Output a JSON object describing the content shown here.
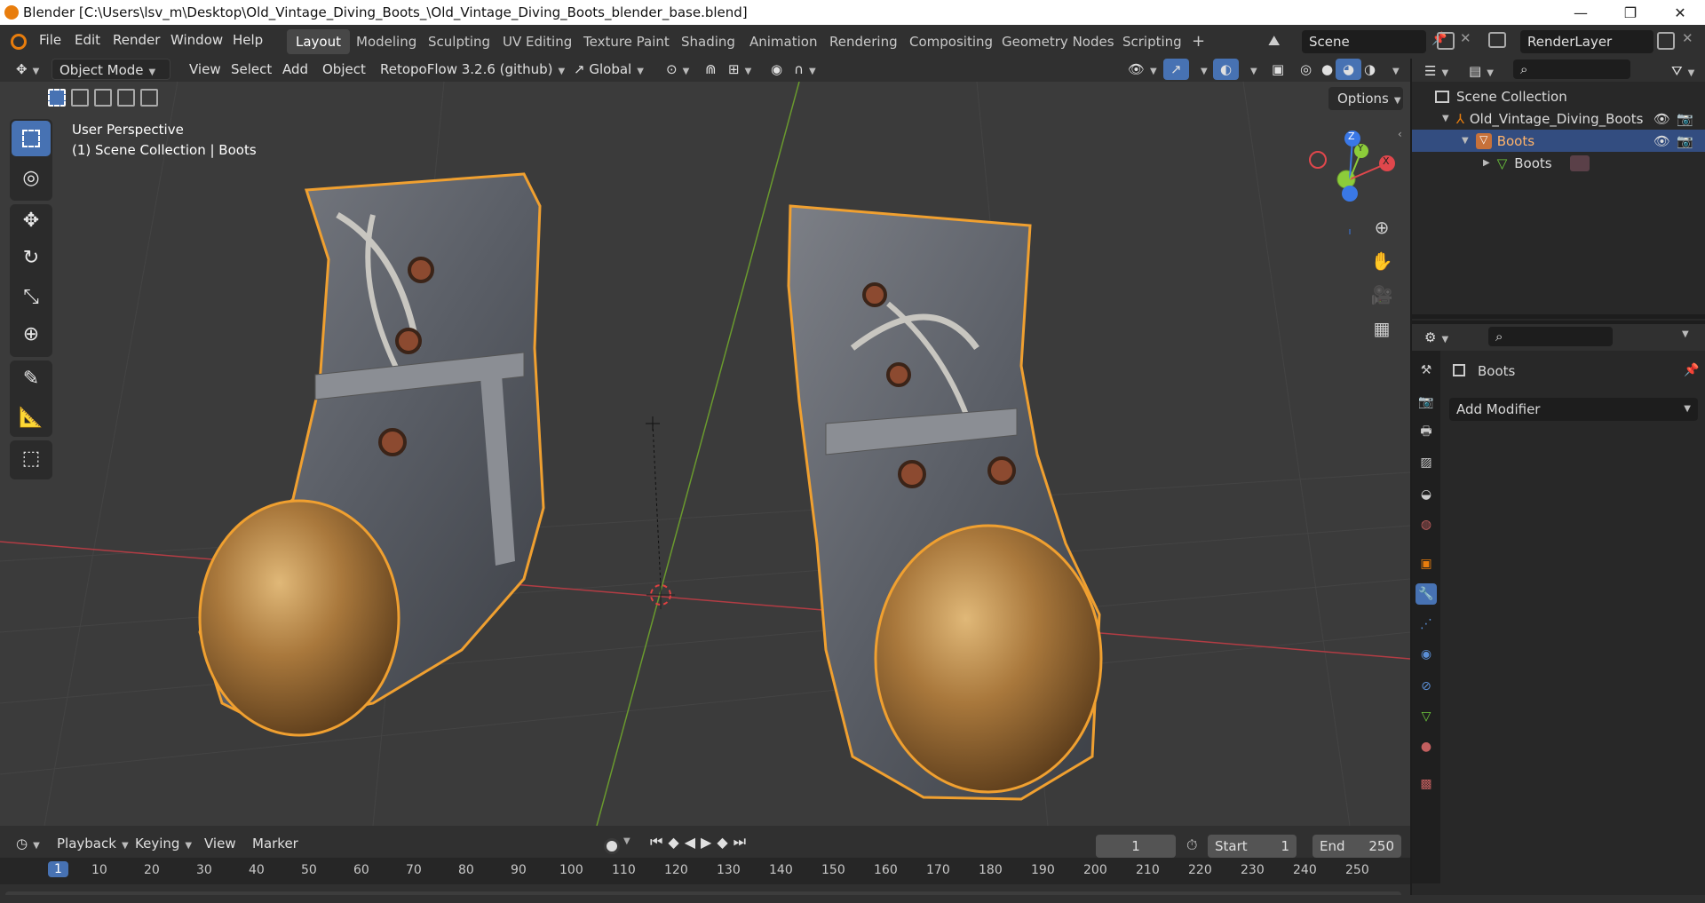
{
  "titlebar": {
    "title": "Blender [C:\\Users\\lsv_m\\Desktop\\Old_Vintage_Diving_Boots_\\Old_Vintage_Diving_Boots_blender_base.blend]",
    "minimize": "—",
    "maximize": "❐",
    "close": "✕"
  },
  "menu": [
    "File",
    "Edit",
    "Render",
    "Window",
    "Help"
  ],
  "workspaces": [
    "Layout",
    "Modeling",
    "Sculpting",
    "UV Editing",
    "Texture Paint",
    "Shading",
    "Animation",
    "Rendering",
    "Compositing",
    "Geometry Nodes",
    "Scripting"
  ],
  "add_workspace": "+",
  "scene": {
    "name": "Scene",
    "view_layer": "RenderLayer"
  },
  "header": {
    "mode": "Object Mode",
    "view": "View",
    "select": "Select",
    "add": "Add",
    "object": "Object",
    "addon": "RetopoFlow 3.2.6 (github)",
    "transform_orientation": "Global",
    "options": "Options"
  },
  "viewport": {
    "perspective": "User Perspective",
    "collection_info": "(1) Scene Collection | Boots",
    "gizmo": {
      "z": "Z",
      "y": "Y",
      "x": "X"
    }
  },
  "timeline": {
    "playback": "Playback",
    "keying": "Keying",
    "view": "View",
    "marker": "Marker",
    "current_frame": "1",
    "start_label": "Start",
    "start": "1",
    "end_label": "End",
    "end": "250",
    "ticks": [
      "1",
      "10",
      "20",
      "30",
      "40",
      "50",
      "60",
      "70",
      "80",
      "90",
      "100",
      "110",
      "120",
      "130",
      "140",
      "150",
      "160",
      "170",
      "180",
      "190",
      "200",
      "210",
      "220",
      "230",
      "240",
      "250"
    ]
  },
  "outliner": {
    "root": "Scene Collection",
    "collection": "Old_Vintage_Diving_Boots",
    "object": "Boots",
    "mesh": "Boots"
  },
  "properties": {
    "object_name": "Boots",
    "add_modifier": "Add Modifier"
  },
  "colors": {
    "accent": "#4772b3",
    "selection_outline": "#f0a030",
    "axis_x": "#e0474c",
    "axis_y": "#8ccc3a",
    "axis_z": "#3a78e6"
  }
}
